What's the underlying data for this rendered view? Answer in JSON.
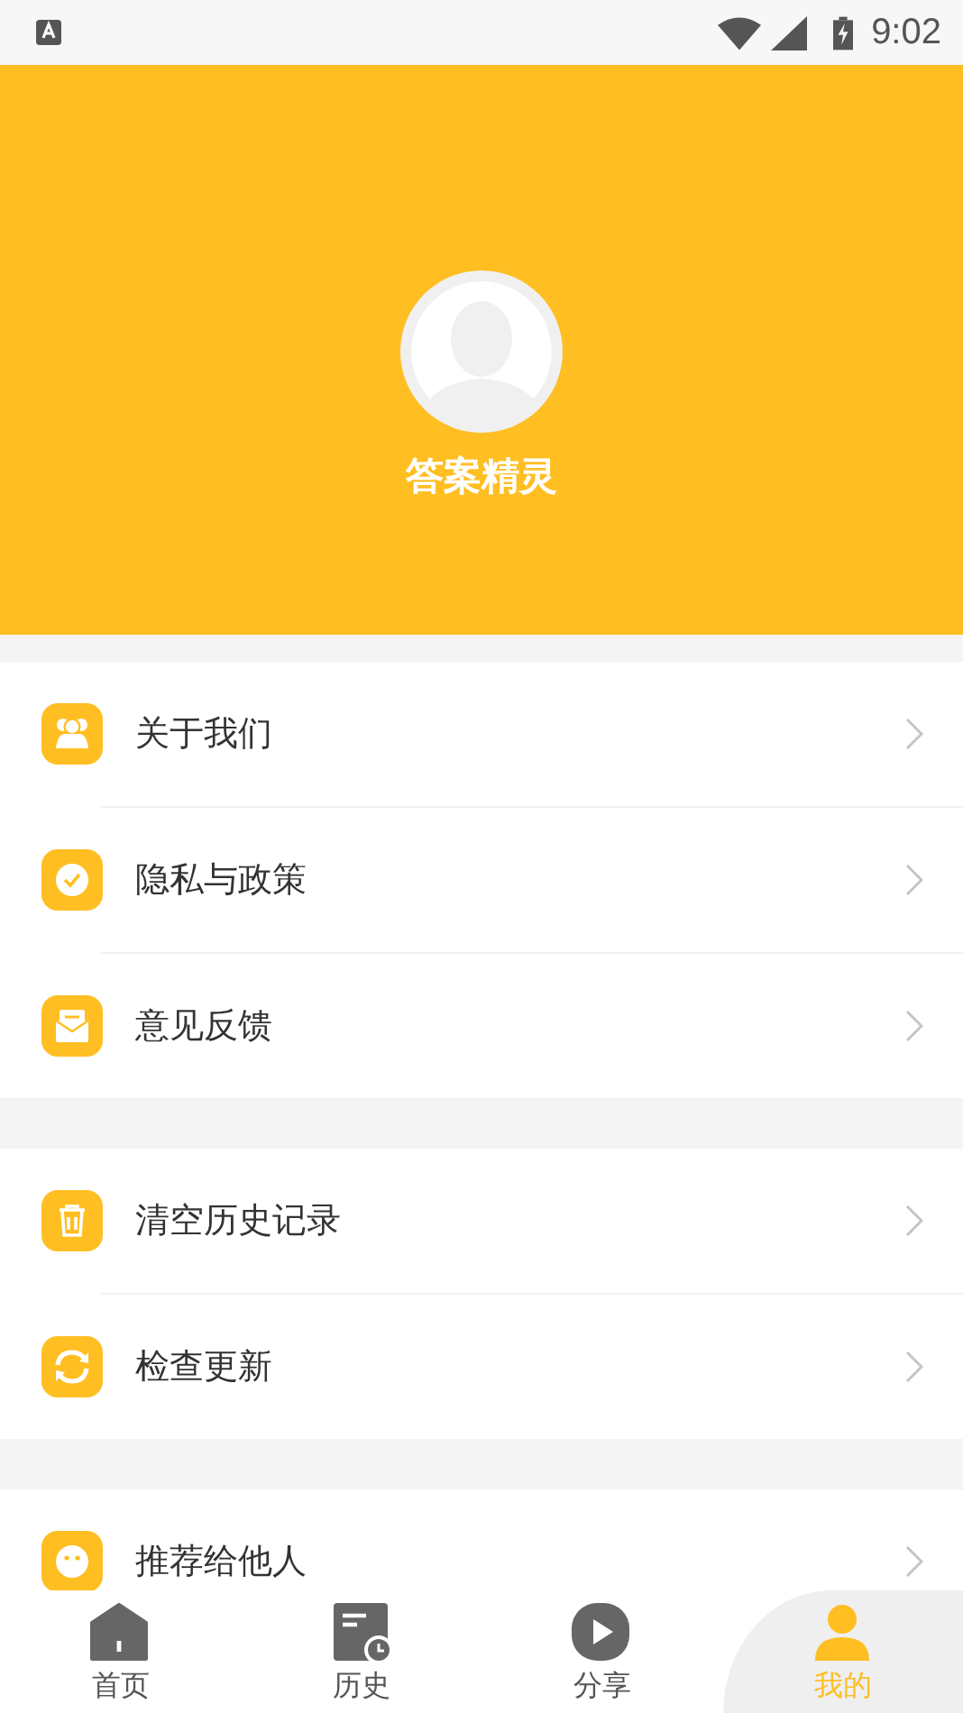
{
  "status_bar": {
    "time": "9:02"
  },
  "profile": {
    "name": "答案精灵"
  },
  "menu_groups": [
    [
      {
        "label": "关于我们"
      },
      {
        "label": "隐私与政策"
      },
      {
        "label": "意见反馈"
      }
    ],
    [
      {
        "label": "清空历史记录"
      },
      {
        "label": "检查更新"
      }
    ],
    [
      {
        "label": "推荐给他人"
      }
    ]
  ],
  "tabs": [
    {
      "label": "首页",
      "selected": false
    },
    {
      "label": "历史",
      "selected": false
    },
    {
      "label": "分享",
      "selected": false
    },
    {
      "label": "我的",
      "selected": true
    }
  ]
}
